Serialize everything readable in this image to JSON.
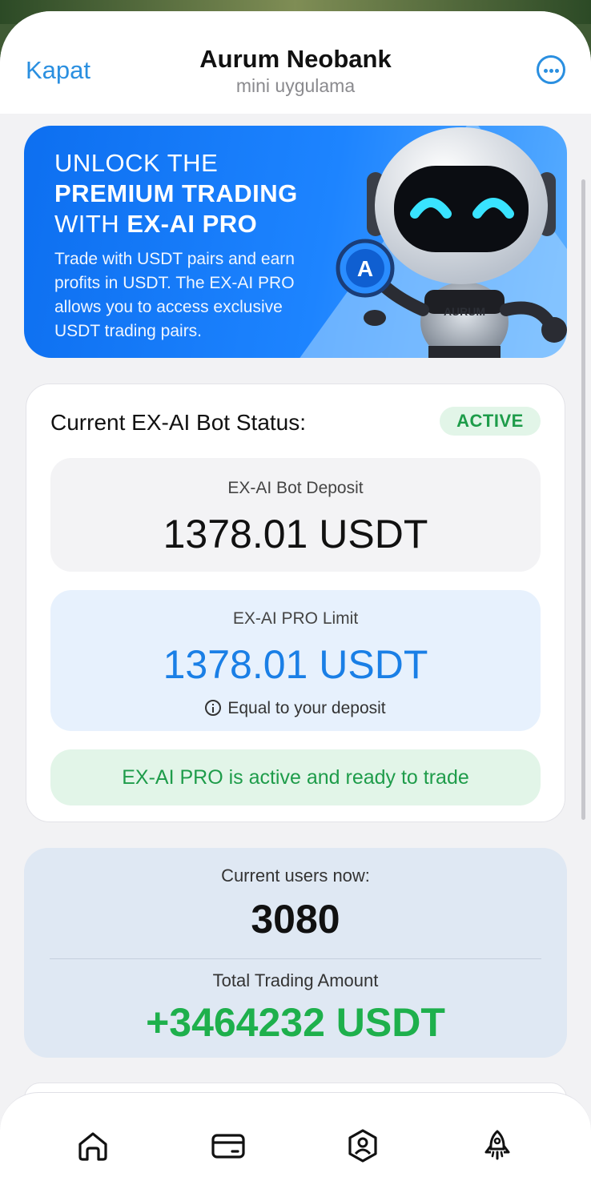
{
  "header": {
    "close_label": "Kapat",
    "title": "Aurum Neobank",
    "subtitle": "mini uygulama",
    "more_icon": "ellipsis-circle-icon",
    "accent_color": "#2a8fe0"
  },
  "banner": {
    "line1": "UNLOCK THE",
    "line2": "PREMIUM TRADING",
    "line3_prefix": "WITH ",
    "line3_bold": "EX-AI PRO",
    "body": "Trade with USDT pairs and earn profits in USDT. The EX-AI PRO allows you to access exclusive USDT trading pairs.",
    "robot_logo_text": "AURUM",
    "robot_badge_letter": "A"
  },
  "status_card": {
    "title": "Current EX-AI Bot Status:",
    "badge": "ACTIVE",
    "deposit_label": "EX-AI Bot Deposit",
    "deposit_value": "1378.01 USDT",
    "limit_label": "EX-AI PRO Limit",
    "limit_value": "1378.01 USDT",
    "limit_note": "Equal to your deposit",
    "ready_message": "EX-AI PRO is active and ready to trade",
    "status_color": "#1e9c4a"
  },
  "stats": {
    "users_label": "Current users now:",
    "users_value": "3080",
    "total_label": "Total Trading Amount",
    "total_value": "+3464232 USDT",
    "total_color": "#1eb04c"
  },
  "bottom_nav": {
    "items": [
      "home-icon",
      "wallet-card-icon",
      "profile-badge-icon",
      "rocket-icon"
    ]
  }
}
